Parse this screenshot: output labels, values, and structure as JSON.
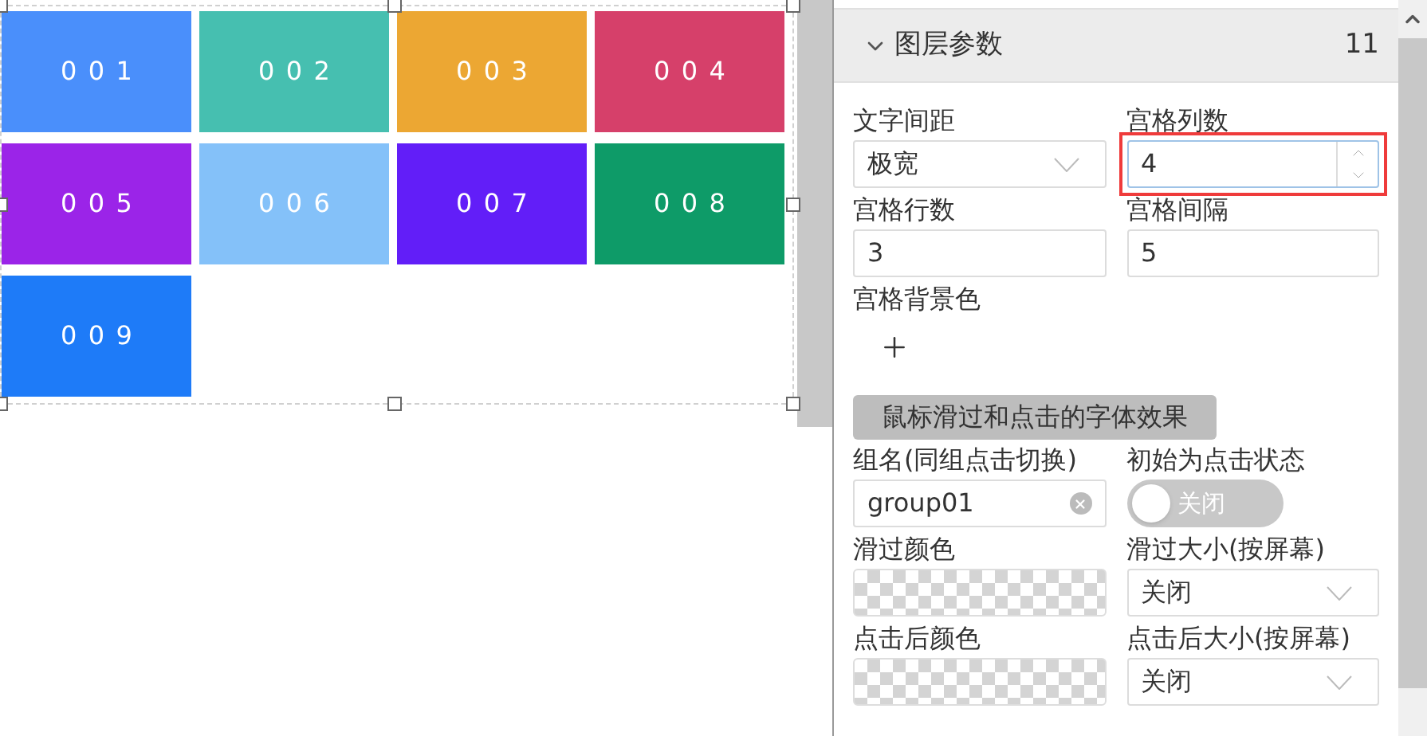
{
  "canvas": {
    "tiles": [
      {
        "label": "001",
        "color": "#4a8ffb"
      },
      {
        "label": "002",
        "color": "#46bfb0"
      },
      {
        "label": "003",
        "color": "#eca733"
      },
      {
        "label": "004",
        "color": "#d6406a"
      },
      {
        "label": "005",
        "color": "#9b24e8"
      },
      {
        "label": "006",
        "color": "#84c1f9"
      },
      {
        "label": "007",
        "color": "#621ef8"
      },
      {
        "label": "008",
        "color": "#0e9b68"
      },
      {
        "label": "009",
        "color": "#1e7bf8"
      }
    ]
  },
  "panel": {
    "title": "图层参数",
    "expanded": true,
    "count": "11",
    "fields": [
      {
        "label": "文字间距",
        "kind": "select",
        "value": "极宽"
      },
      {
        "label": "宫格列数",
        "kind": "number",
        "value": "4",
        "highlighted": true
      },
      {
        "label": "宫格行数",
        "kind": "text",
        "value": "3"
      },
      {
        "label": "宫格间隔",
        "kind": "text",
        "value": "5"
      },
      {
        "label": "宫格背景色",
        "kind": "add"
      }
    ],
    "section_button": "鼠标滑过和点击的字体效果",
    "effect_fields": [
      {
        "label": "组名(同组点击切换)",
        "kind": "clearable",
        "value": "group01"
      },
      {
        "label": "初始为点击状态",
        "kind": "switch",
        "on": false,
        "value": "关闭"
      },
      {
        "label": "滑过颜色",
        "kind": "color"
      },
      {
        "label": "滑过大小(按屏幕)",
        "kind": "select",
        "value": "关闭"
      },
      {
        "label": "点击后颜色",
        "kind": "color"
      },
      {
        "label": "点击后大小(按屏幕)",
        "kind": "select",
        "value": "关闭"
      }
    ]
  }
}
